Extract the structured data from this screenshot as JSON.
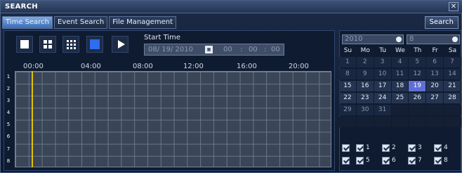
{
  "window": {
    "title": "SEARCH",
    "close_label": "✕"
  },
  "tabs": [
    {
      "label": "Time Search",
      "active": true
    },
    {
      "label": "Event Search",
      "active": false
    },
    {
      "label": "File Management",
      "active": false
    }
  ],
  "search_button": "Search",
  "layout_buttons": [
    "single-view-icon",
    "quad-view-icon",
    "nine-view-icon",
    "sixteen-view-icon"
  ],
  "play_icon": "play-icon",
  "start_time": {
    "label": "Start Time",
    "date": "08/ 19/ 2010",
    "calendar_icon": "calendar-icon",
    "hour": "00",
    "minute": "00",
    "second": "00"
  },
  "timeline": {
    "hours": [
      "00:00",
      "04:00",
      "08:00",
      "12:00",
      "16:00",
      "20:00"
    ],
    "channels": [
      "1",
      "2",
      "3",
      "4",
      "5",
      "6",
      "7",
      "8"
    ],
    "cursor_hour": 0
  },
  "calendar": {
    "year": "2010",
    "month": "8",
    "weekdays": [
      "Su",
      "Mo",
      "Tu",
      "We",
      "Th",
      "Fr",
      "Sa"
    ],
    "rows": [
      [
        "1",
        "2",
        "3",
        "4",
        "5",
        "6",
        "7"
      ],
      [
        "8",
        "9",
        "10",
        "11",
        "12",
        "13",
        "14"
      ],
      [
        "15",
        "16",
        "17",
        "18",
        "19",
        "20",
        "21"
      ],
      [
        "22",
        "23",
        "24",
        "25",
        "26",
        "27",
        "28"
      ],
      [
        "29",
        "30",
        "31",
        "",
        "",
        "",
        ""
      ],
      [
        "",
        "",
        "",
        "",
        "",
        "",
        ""
      ]
    ],
    "selected_day": "19"
  },
  "channel_checks": [
    {
      "label": "",
      "checked": true
    },
    {
      "label": "1",
      "checked": true
    },
    {
      "label": "2",
      "checked": true
    },
    {
      "label": "3",
      "checked": true
    },
    {
      "label": "4",
      "checked": true
    },
    {
      "label": "",
      "checked": true
    },
    {
      "label": "5",
      "checked": true
    },
    {
      "label": "6",
      "checked": true
    },
    {
      "label": "7",
      "checked": true
    },
    {
      "label": "8",
      "checked": true
    }
  ],
  "colors": {
    "accent": "#5f6fd6",
    "cursor": "#e0c200",
    "active_tab": "#3d6bb5"
  }
}
